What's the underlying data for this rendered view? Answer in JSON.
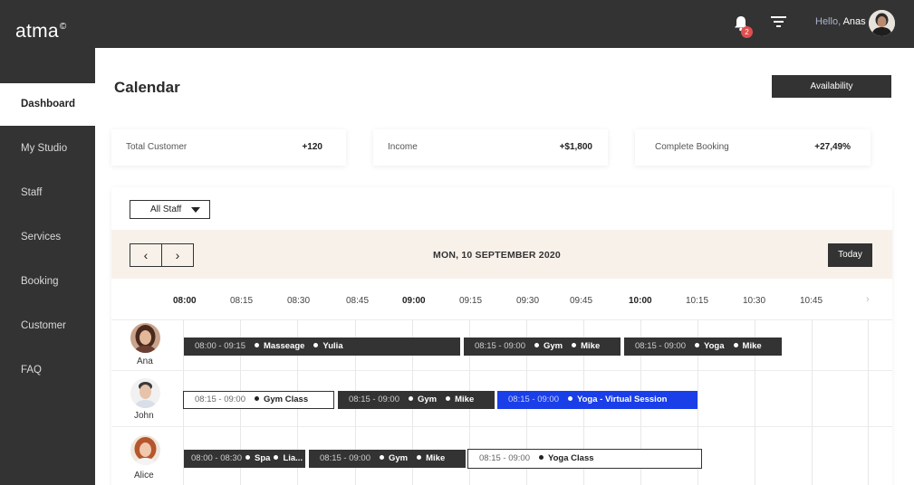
{
  "app": {
    "logo": "atma",
    "logo_mark": "©"
  },
  "header": {
    "notifications_count": "2",
    "greeting": "Hello,",
    "user_name": "Anas"
  },
  "sidebar": {
    "items": [
      {
        "label": "Dashboard",
        "active": true
      },
      {
        "label": "My Studio"
      },
      {
        "label": "Staff"
      },
      {
        "label": "Services"
      },
      {
        "label": "Booking"
      },
      {
        "label": "Customer"
      },
      {
        "label": "FAQ"
      }
    ]
  },
  "main": {
    "title": "Calendar",
    "availability_label": "Availability",
    "stats": [
      {
        "label": "Total Customer",
        "value": "+120"
      },
      {
        "label": "Income",
        "value": "+$1,800"
      },
      {
        "label": "Complete Booking",
        "value": "+27,49%"
      }
    ],
    "staff_filter": "All Staff",
    "date": "MON, 10 SEPTEMBER 2020",
    "today_label": "Today",
    "prev_icon": "‹",
    "next_icon": "›",
    "times": [
      "08:00",
      "08:15",
      "08:30",
      "08:45",
      "09:00",
      "09:15",
      "09:30",
      "09:45",
      "10:00",
      "10:15",
      "10:30",
      "10:45"
    ],
    "next_times_icon": "›",
    "staff": [
      {
        "name": "Ana",
        "events": [
          {
            "time": "08:00 - 09:15",
            "items": [
              "Masseage",
              "Yulia"
            ],
            "style": "dark"
          },
          {
            "time": "08:15 - 09:00",
            "items": [
              "Gym",
              "Mike"
            ],
            "style": "dark"
          },
          {
            "time": "08:15 - 09:00",
            "items": [
              "Yoga",
              "Mike"
            ],
            "style": "dark"
          }
        ]
      },
      {
        "name": "John",
        "events": [
          {
            "time": "08:15 - 09:00",
            "items": [
              "Gym Class"
            ],
            "style": "outline"
          },
          {
            "time": "08:15 - 09:00",
            "items": [
              "Gym",
              "Mike"
            ],
            "style": "dark"
          },
          {
            "time": "08:15 - 09:00",
            "items": [
              "Yoga - Virtual Session"
            ],
            "style": "blue"
          }
        ]
      },
      {
        "name": "Alice",
        "events": [
          {
            "time": "08:00 - 08:30",
            "items": [
              "Spa",
              "Lia..."
            ],
            "style": "dark"
          },
          {
            "time": "08:15 - 09:00",
            "items": [
              "Gym",
              "Mike"
            ],
            "style": "dark"
          },
          {
            "time": "08:15 - 09:00",
            "items": [
              "Yoga Class"
            ],
            "style": "outline"
          }
        ]
      }
    ]
  },
  "colors": {
    "dark": "#333333",
    "accent_blue": "#1a3ee8",
    "badge_red": "#e04f4f",
    "date_bar_bg": "#f8f1ea"
  }
}
